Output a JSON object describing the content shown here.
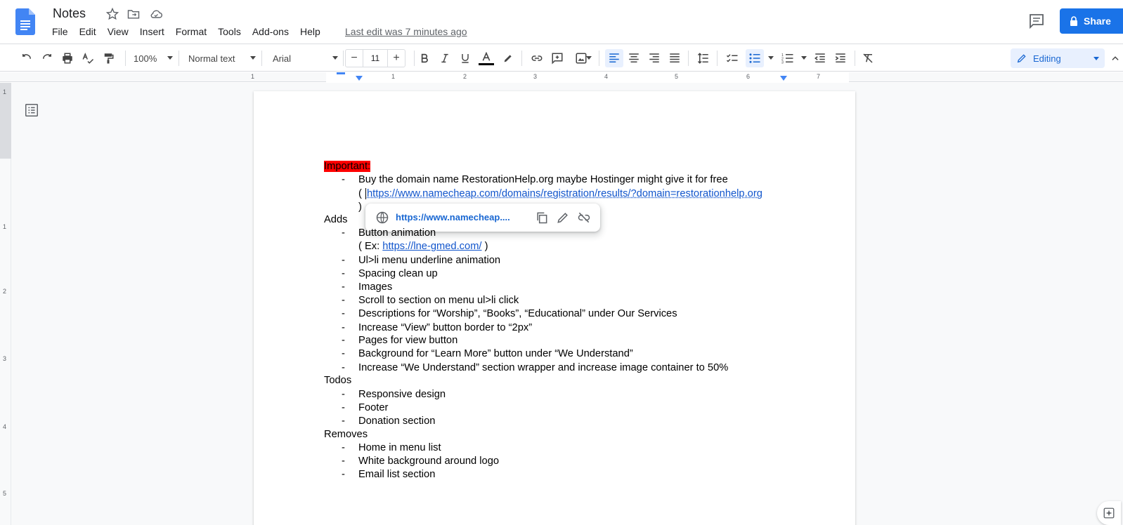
{
  "doc": {
    "title": "Notes",
    "last_edit": "Last edit was 7 minutes ago"
  },
  "menu": [
    "File",
    "Edit",
    "View",
    "Insert",
    "Format",
    "Tools",
    "Add-ons",
    "Help"
  ],
  "share_label": "Share",
  "toolbar": {
    "zoom": "100%",
    "style": "Normal text",
    "font": "Arial",
    "font_size": "11",
    "mode": "Editing"
  },
  "ruler": {
    "top_numbers": [
      "1",
      "1",
      "2",
      "3",
      "4",
      "5",
      "6",
      "7"
    ],
    "left_numbers": [
      "1",
      "1",
      "2",
      "3",
      "4",
      "5"
    ]
  },
  "colors": {
    "accent": "#1a73e8",
    "highlight": "#ff0000",
    "link": "#1155cc"
  },
  "content": {
    "important_heading": "Important:",
    "important_item_1": "Buy the domain name RestorationHelp.org maybe Hostinger might give it for free",
    "important_link_open": "(",
    "important_link": "https://www.namecheap.com/domains/registration/results/?domain=restorationhelp.org",
    "important_link_close": ")",
    "adds_heading": "Adds",
    "adds_item_1": "Button animation",
    "adds_example_prefix": "( Ex: ",
    "adds_example_link": "https://lne-gmed.com/",
    "adds_example_suffix": " )",
    "adds_items": [
      "Ul>li menu underline animation",
      "Spacing clean up",
      "Images",
      "Scroll to section on menu ul>li click",
      "Descriptions for “Worship”, “Books”, “Educational” under Our Services",
      "Increase “View” button border to “2px”",
      "Pages for view button",
      "Background for “Learn More” button under “We Understand”",
      "Increase “We Understand” section wrapper and increase image container to 50%"
    ],
    "todos_heading": "Todos",
    "todos_items": [
      "Responsive design",
      "Footer",
      "Donation section"
    ],
    "removes_heading": "Removes",
    "removes_items": [
      "Home in menu list",
      "White background around logo",
      "Email list section"
    ],
    "bullet": "-"
  },
  "link_popup": {
    "url": "https://www.namecheap....",
    "icons": [
      "globe-icon",
      "copy-icon",
      "edit-icon",
      "unlink-icon"
    ]
  }
}
